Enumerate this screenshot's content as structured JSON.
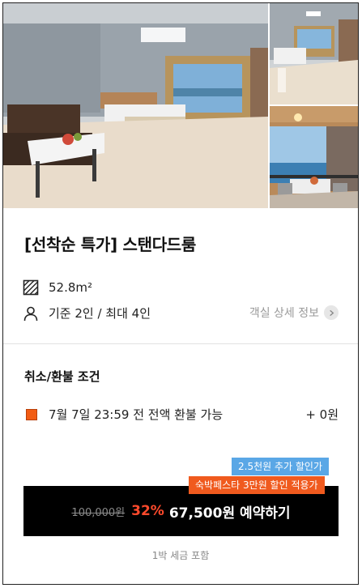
{
  "colors": {
    "accent_orange": "#f05a1e",
    "discount_red": "#ff4a2c",
    "badge_blue": "#5aa7e6",
    "button_bg": "#000000"
  },
  "gallery": {
    "photos": [
      {
        "name": "main-room-photo"
      },
      {
        "name": "room-side-photo"
      },
      {
        "name": "balcony-photo"
      }
    ]
  },
  "room": {
    "title": "[선착순 특가] 스탠다드룸",
    "size": "52.8m²",
    "capacity": "기준 2인 / 최대 4인",
    "detail_link": "객실 상세 정보"
  },
  "cancellation": {
    "section_title": "취소/환불 조건",
    "policy_text": "7월 7일 23:59 전 전액 환불 가능",
    "policy_amount": "+ 0원"
  },
  "promo": {
    "extra_discount_badge": "2.5천원 추가 할인가",
    "festa_badge": "숙박페스타 3만원 할인 적용가"
  },
  "reserve": {
    "original_price": "100,000원",
    "discount_rate": "32%",
    "label": "67,500원 예약하기"
  },
  "tax_note": "1박 세금 포함",
  "icons": {
    "size": "hatched-square-icon",
    "capacity": "person-icon",
    "detail": "chevron-right-icon"
  }
}
